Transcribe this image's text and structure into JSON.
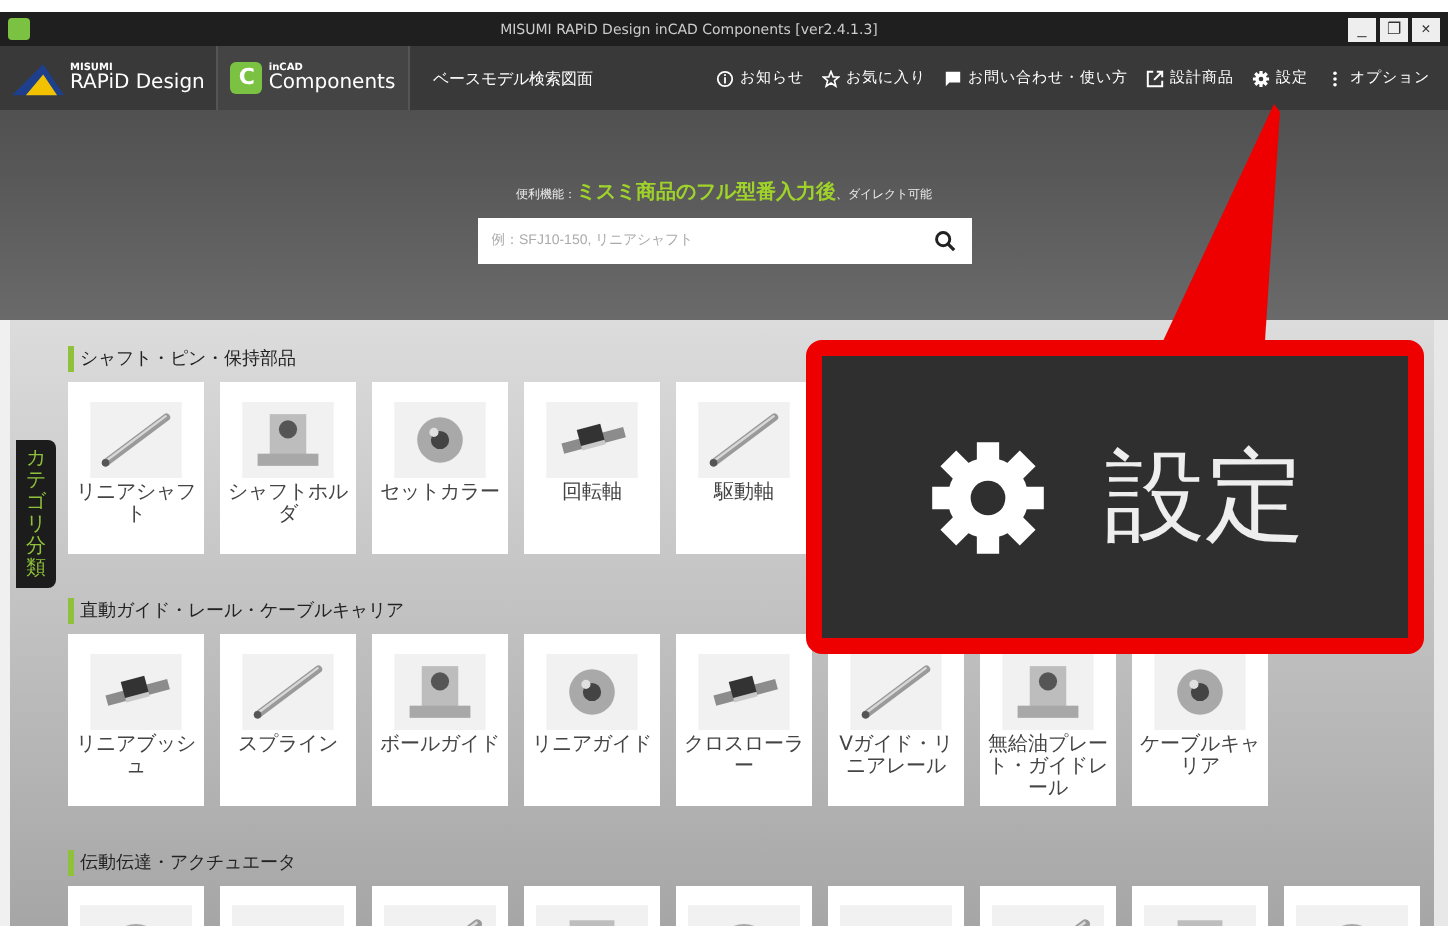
{
  "window": {
    "title": "MISUMI RAPiD Design inCAD Components [ver2.4.1.3]",
    "controls": [
      "_",
      "❐",
      "×"
    ]
  },
  "toolbar": {
    "brand_top": "MISUMI",
    "brand_name": "RAPiD Design",
    "app_icon": "C",
    "app_top": "inCAD",
    "app_name": "Components",
    "nav": "ベースモデル検索図面",
    "actions": [
      {
        "label": "お知らせ",
        "kind": "info"
      },
      {
        "label": "お気に入り",
        "kind": "star"
      },
      {
        "label": "お問い合わせ・使い方",
        "kind": "chat"
      },
      {
        "label": "設計商品",
        "kind": "external"
      },
      {
        "label": "設定",
        "kind": "gear"
      },
      {
        "label": "オプション",
        "kind": "dots"
      }
    ]
  },
  "search": {
    "hint_prefix": "便利機能：",
    "hint_highlight": "ミスミ商品のフル型番入力後",
    "hint_suffix": "、ダイレクト可能",
    "placeholder": "例：SFJ10-150, リニアシャフト"
  },
  "sidebar_tab": "カテゴリ分類",
  "categories": [
    {
      "title": "シャフト・ピン・保持部品",
      "items": [
        {
          "label": "リニアシャフト"
        },
        {
          "label": "シャフトホルダ"
        },
        {
          "label": "セットカラー"
        },
        {
          "label": "回転軸"
        },
        {
          "label": "駆動軸"
        }
      ]
    },
    {
      "title": "直動ガイド・レール・ケーブルキャリア",
      "items": [
        {
          "label": "リニアブッシュ"
        },
        {
          "label": "スプライン"
        },
        {
          "label": "ボールガイド"
        },
        {
          "label": "リニアガイド"
        },
        {
          "label": "クロスローラー"
        },
        {
          "label": "Vガイド・リニアレール"
        },
        {
          "label": "無給油プレート・ガイドレール"
        },
        {
          "label": "ケーブルキャリア"
        }
      ]
    },
    {
      "title": "伝動伝達・アクチュエータ"
    }
  ],
  "callout": {
    "label": "設定"
  }
}
